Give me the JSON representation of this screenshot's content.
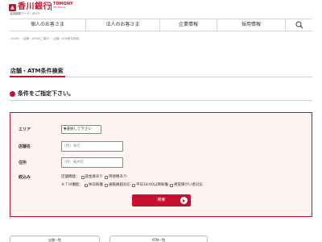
{
  "header": {
    "logo_text": "香川銀行",
    "brand": "TOMONY",
    "brand_sub": "HOLDINGS",
    "bank_code": "金融機関コード：0573",
    "accent_color": "#c8102e"
  },
  "nav": {
    "items": [
      "個人のお客さま",
      "法人のお客さま",
      "企業情報",
      "採用情報"
    ],
    "search_icon": "search-icon"
  },
  "breadcrumb": [
    "HOME",
    "店舗・ATMのご案内",
    "店舗・ATM条件検索"
  ],
  "page_title": "店舗・ATM条件検索",
  "section_heading": "条件をご指定下さい。",
  "form": {
    "area_label": "エリア",
    "area_value": "▼選択して下さい",
    "store_label": "店舗名",
    "store_placeholder": "(例）本店",
    "address_label": "住所",
    "address_placeholder": "(例）亀井町",
    "filter_label": "絞込み",
    "store_func_label": "店舗機能：",
    "store_options": [
      "貸金庫あり",
      "両替機あり"
    ],
    "atm_func_label": "ＡＴＭ機能：",
    "atm_options": [
      "休日稼働",
      "通帳繰越対応",
      "平日18:00以降稼働",
      "視覚障がい者対応"
    ],
    "search_button": "検索"
  },
  "cards": [
    "店舗一覧",
    "ATM一覧"
  ]
}
